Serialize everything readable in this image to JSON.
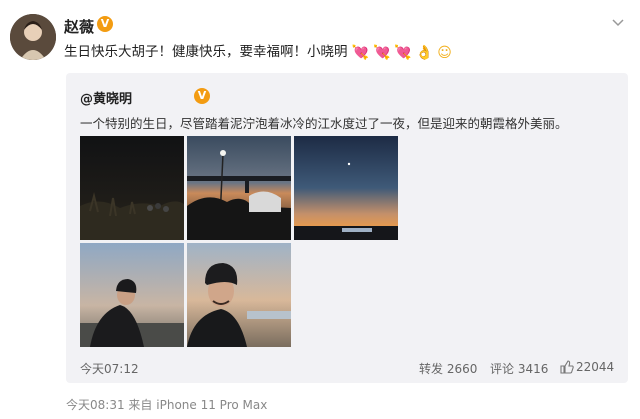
{
  "post": {
    "author": "赵薇",
    "verified_badge": "V",
    "text": "生日快乐大胡子！健康快乐，要幸福啊！小晓明",
    "emojis": [
      "💘",
      "💘",
      "💘",
      "👌",
      "☺"
    ],
    "time": "今天08:31",
    "device_sep": "来自",
    "device": "iPhone 11 Pro Max"
  },
  "repost": {
    "author": "@黄晓明",
    "verified_badge": "V",
    "text": "一个特别的生日，尽管踏着泥泞泡着冰冷的江水度过了一夜，但是迎来的朝霞格外美丽。",
    "time": "今天07:12",
    "shares_label": "转发",
    "shares": "2660",
    "comments_label": "评论",
    "comments": "3416",
    "likes": "22044",
    "photos": [
      {
        "name": "night-riverbank-photo"
      },
      {
        "name": "bridge-dusk-photo"
      },
      {
        "name": "sunrise-horizon-photo"
      },
      {
        "name": "portrait-man-beanie-photo"
      },
      {
        "name": "closeup-man-beanie-photo"
      }
    ]
  },
  "colors": {
    "verified": "#f39c12",
    "repost_bg": "#f2f2f5",
    "heart": "#ff5d8f"
  }
}
